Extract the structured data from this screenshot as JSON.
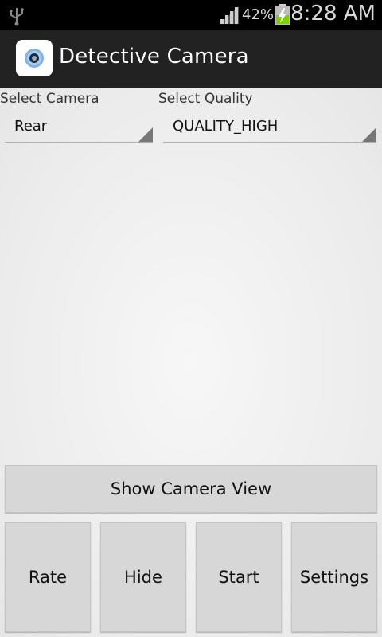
{
  "status_bar": {
    "battery_percent": "42%",
    "time": "8:28 AM",
    "icons": [
      "usb-icon",
      "signal-icon",
      "battery-charging-icon"
    ]
  },
  "action_bar": {
    "title": "Detective Camera",
    "icon": "camera-lens-icon"
  },
  "camera_select": {
    "label": "Select Camera",
    "value": "Rear"
  },
  "quality_select": {
    "label": "Select Quality",
    "value": "QUALITY_HIGH"
  },
  "buttons": {
    "show_camera_view": "Show Camera View",
    "rate": "Rate",
    "hide": "Hide",
    "start": "Start",
    "settings": "Settings"
  },
  "colors": {
    "action_bar": "#222222",
    "status_bar": "#000000",
    "button": "#d7d7d7",
    "battery_charge": "#7bd000"
  }
}
